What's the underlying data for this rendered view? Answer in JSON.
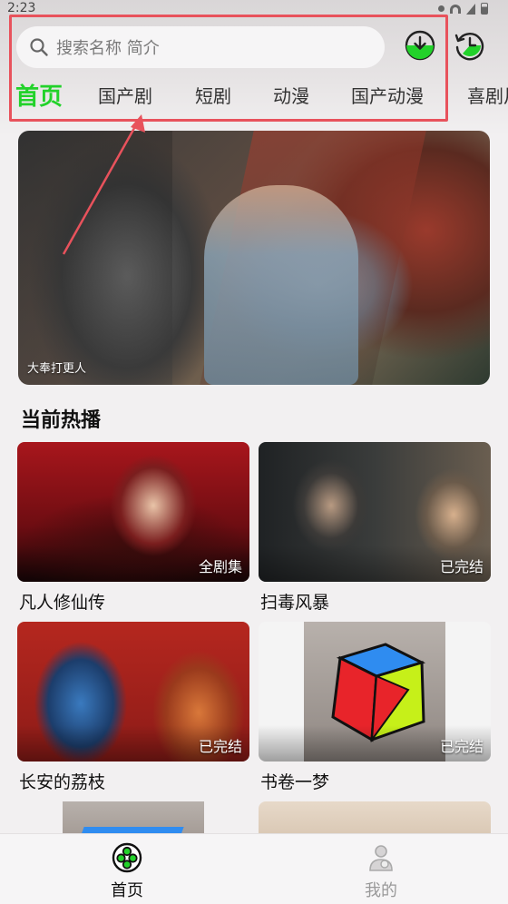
{
  "status_bar": {
    "time": "2:23"
  },
  "header": {
    "search_placeholder": "搜索名称 简介",
    "download_icon": "download-icon",
    "history_icon": "history-icon"
  },
  "tabs": [
    {
      "label": "首页",
      "active": true
    },
    {
      "label": "国产剧",
      "active": false
    },
    {
      "label": "短剧",
      "active": false
    },
    {
      "label": "动漫",
      "active": false
    },
    {
      "label": "国产动漫",
      "active": false
    },
    {
      "label": "喜剧片",
      "active": false
    }
  ],
  "banner": {
    "caption": "大奉打更人"
  },
  "section": {
    "title": "当前热播"
  },
  "cards": [
    {
      "title": "凡人修仙传",
      "badge": "全剧集"
    },
    {
      "title": "扫毒风暴",
      "badge": "已完结"
    },
    {
      "title": "长安的荔枝",
      "badge": "已完结"
    },
    {
      "title": "书卷一梦",
      "badge": "已完结"
    }
  ],
  "bottom_nav": [
    {
      "label": "首页",
      "icon": "home-icon",
      "active": true
    },
    {
      "label": "我的",
      "icon": "profile-icon",
      "active": false
    }
  ],
  "colors": {
    "accent": "#22d22a",
    "highlight": "#e8525c"
  }
}
